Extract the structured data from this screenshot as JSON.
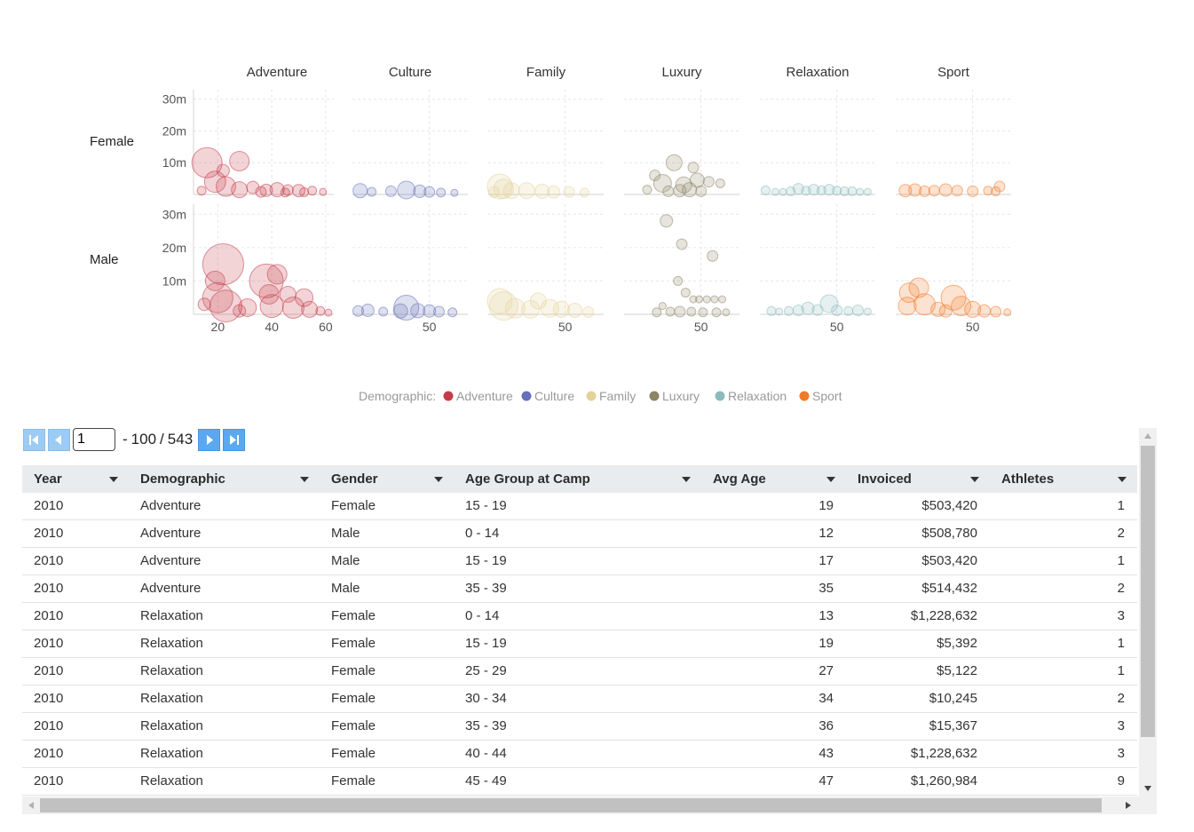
{
  "chart_data": {
    "type": "scatter",
    "facet_columns": [
      "Adventure",
      "Culture",
      "Family",
      "Luxury",
      "Relaxation",
      "Sport"
    ],
    "facet_rows": [
      "Female",
      "Male"
    ],
    "y_ticks": [
      "10m",
      "20m",
      "30m"
    ],
    "x_ticks_first": [
      "20",
      "40",
      "60"
    ],
    "x_ticks_other": [
      "50"
    ],
    "ylim": [
      0,
      33
    ],
    "x_range_first": [
      11,
      63
    ],
    "x_range_other": [
      10,
      70
    ],
    "colors": {
      "Adventure": "#c43c48",
      "Culture": "#6670b8",
      "Family": "#e5d19a",
      "Luxury": "#8c8566",
      "Relaxation": "#8bbcbc",
      "Sport": "#f07a2a"
    },
    "legend": {
      "title": "Demographic:",
      "items": [
        "Adventure",
        "Culture",
        "Family",
        "Luxury",
        "Relaxation",
        "Sport"
      ],
      "placement": "bottom-center"
    },
    "series": [
      {
        "name": "Adventure",
        "gender": "Female",
        "points": [
          {
            "x": 16,
            "y": 10,
            "r": 17
          },
          {
            "x": 28,
            "y": 10.5,
            "r": 11
          },
          {
            "x": 22,
            "y": 7.5,
            "r": 7
          },
          {
            "x": 19,
            "y": 4,
            "r": 12
          },
          {
            "x": 23,
            "y": 2.5,
            "r": 11
          },
          {
            "x": 28,
            "y": 1.5,
            "r": 9
          },
          {
            "x": 33,
            "y": 2.2,
            "r": 7
          },
          {
            "x": 38,
            "y": 1.3,
            "r": 7
          },
          {
            "x": 42,
            "y": 1.5,
            "r": 8
          },
          {
            "x": 46,
            "y": 1.4,
            "r": 6
          },
          {
            "x": 50,
            "y": 1.2,
            "r": 7
          },
          {
            "x": 55,
            "y": 1.2,
            "r": 5
          },
          {
            "x": 59,
            "y": 0.8,
            "r": 4
          },
          {
            "x": 14,
            "y": 1.2,
            "r": 5
          },
          {
            "x": 36,
            "y": 0.8,
            "r": 6
          },
          {
            "x": 45,
            "y": 0.6,
            "r": 5
          },
          {
            "x": 52,
            "y": 0.7,
            "r": 5
          }
        ]
      },
      {
        "name": "Adventure",
        "gender": "Male",
        "points": [
          {
            "x": 22,
            "y": 15,
            "r": 23
          },
          {
            "x": 19,
            "y": 10,
            "r": 11
          },
          {
            "x": 20,
            "y": 5,
            "r": 17
          },
          {
            "x": 23,
            "y": 2.5,
            "r": 18
          },
          {
            "x": 38,
            "y": 10,
            "r": 19
          },
          {
            "x": 42,
            "y": 12,
            "r": 11
          },
          {
            "x": 39,
            "y": 6,
            "r": 11
          },
          {
            "x": 46,
            "y": 6,
            "r": 9
          },
          {
            "x": 52,
            "y": 5,
            "r": 10
          },
          {
            "x": 40,
            "y": 2.5,
            "r": 13
          },
          {
            "x": 48,
            "y": 2,
            "r": 12
          },
          {
            "x": 54,
            "y": 1.5,
            "r": 9
          },
          {
            "x": 31,
            "y": 2,
            "r": 10
          },
          {
            "x": 15,
            "y": 3,
            "r": 7
          },
          {
            "x": 28,
            "y": 1,
            "r": 7
          },
          {
            "x": 58,
            "y": 1,
            "r": 5
          },
          {
            "x": 61,
            "y": 0.5,
            "r": 4
          }
        ]
      },
      {
        "name": "Culture",
        "gender": "Female",
        "points": [
          {
            "x": 14,
            "y": 1.2,
            "r": 8
          },
          {
            "x": 20,
            "y": 0.8,
            "r": 5
          },
          {
            "x": 30,
            "y": 1,
            "r": 6
          },
          {
            "x": 38,
            "y": 1.4,
            "r": 10
          },
          {
            "x": 45,
            "y": 1,
            "r": 7
          },
          {
            "x": 50,
            "y": 0.8,
            "r": 6
          },
          {
            "x": 56,
            "y": 0.6,
            "r": 5
          },
          {
            "x": 63,
            "y": 0.5,
            "r": 4
          }
        ]
      },
      {
        "name": "Culture",
        "gender": "Male",
        "points": [
          {
            "x": 13,
            "y": 1,
            "r": 6
          },
          {
            "x": 18,
            "y": 1.2,
            "r": 7
          },
          {
            "x": 26,
            "y": 0.8,
            "r": 5
          },
          {
            "x": 35,
            "y": 1,
            "r": 8
          },
          {
            "x": 38,
            "y": 2,
            "r": 14
          },
          {
            "x": 44,
            "y": 1.1,
            "r": 8
          },
          {
            "x": 50,
            "y": 1,
            "r": 7
          },
          {
            "x": 55,
            "y": 0.8,
            "r": 6
          },
          {
            "x": 62,
            "y": 0.6,
            "r": 5
          }
        ]
      },
      {
        "name": "Family",
        "gender": "Female",
        "points": [
          {
            "x": 16,
            "y": 2.5,
            "r": 14
          },
          {
            "x": 18,
            "y": 1.8,
            "r": 11
          },
          {
            "x": 22,
            "y": 1.2,
            "r": 9
          },
          {
            "x": 30,
            "y": 1.2,
            "r": 9
          },
          {
            "x": 38,
            "y": 1,
            "r": 8
          },
          {
            "x": 44,
            "y": 0.8,
            "r": 7
          },
          {
            "x": 52,
            "y": 0.8,
            "r": 6
          },
          {
            "x": 60,
            "y": 0.6,
            "r": 5
          },
          {
            "x": 13,
            "y": 0.8,
            "r": 6
          }
        ]
      },
      {
        "name": "Family",
        "gender": "Male",
        "points": [
          {
            "x": 16,
            "y": 4,
            "r": 14
          },
          {
            "x": 18,
            "y": 2.5,
            "r": 16
          },
          {
            "x": 24,
            "y": 1.8,
            "r": 11
          },
          {
            "x": 32,
            "y": 1.5,
            "r": 10
          },
          {
            "x": 36,
            "y": 4,
            "r": 9
          },
          {
            "x": 42,
            "y": 1.8,
            "r": 10
          },
          {
            "x": 48,
            "y": 1.5,
            "r": 9
          },
          {
            "x": 55,
            "y": 1.2,
            "r": 8
          },
          {
            "x": 62,
            "y": 0.7,
            "r": 6
          }
        ]
      },
      {
        "name": "Luxury",
        "gender": "Female",
        "points": [
          {
            "x": 36,
            "y": 10,
            "r": 9
          },
          {
            "x": 46,
            "y": 8.5,
            "r": 6
          },
          {
            "x": 26,
            "y": 6,
            "r": 6
          },
          {
            "x": 30,
            "y": 3.5,
            "r": 10
          },
          {
            "x": 41,
            "y": 3,
            "r": 9
          },
          {
            "x": 48,
            "y": 4.5,
            "r": 8
          },
          {
            "x": 54,
            "y": 4,
            "r": 6
          },
          {
            "x": 60,
            "y": 3.5,
            "r": 5
          },
          {
            "x": 22,
            "y": 1.5,
            "r": 5
          },
          {
            "x": 33,
            "y": 1,
            "r": 6
          },
          {
            "x": 39,
            "y": 1.2,
            "r": 7
          },
          {
            "x": 44,
            "y": 1.5,
            "r": 8
          },
          {
            "x": 50,
            "y": 1,
            "r": 6
          }
        ]
      },
      {
        "name": "Luxury",
        "gender": "Male",
        "points": [
          {
            "x": 32,
            "y": 28,
            "r": 7
          },
          {
            "x": 40,
            "y": 21,
            "r": 6
          },
          {
            "x": 56,
            "y": 17.5,
            "r": 6
          },
          {
            "x": 38,
            "y": 10,
            "r": 5
          },
          {
            "x": 42,
            "y": 6.5,
            "r": 5
          },
          {
            "x": 46,
            "y": 4.5,
            "r": 4
          },
          {
            "x": 49,
            "y": 4.5,
            "r": 4
          },
          {
            "x": 53,
            "y": 4.5,
            "r": 4
          },
          {
            "x": 57,
            "y": 4.5,
            "r": 4
          },
          {
            "x": 61,
            "y": 4.5,
            "r": 4
          },
          {
            "x": 30,
            "y": 2.5,
            "r": 4
          },
          {
            "x": 27,
            "y": 0.6,
            "r": 5
          },
          {
            "x": 34,
            "y": 0.8,
            "r": 5
          },
          {
            "x": 39,
            "y": 0.8,
            "r": 6
          },
          {
            "x": 45,
            "y": 0.8,
            "r": 5
          },
          {
            "x": 51,
            "y": 0.6,
            "r": 5
          },
          {
            "x": 58,
            "y": 0.6,
            "r": 5
          },
          {
            "x": 63,
            "y": 0.6,
            "r": 4
          }
        ]
      },
      {
        "name": "Relaxation",
        "gender": "Female",
        "points": [
          {
            "x": 13,
            "y": 1.3,
            "r": 5
          },
          {
            "x": 18,
            "y": 0.8,
            "r": 4
          },
          {
            "x": 22,
            "y": 0.8,
            "r": 4
          },
          {
            "x": 26,
            "y": 1,
            "r": 5
          },
          {
            "x": 30,
            "y": 1.8,
            "r": 6
          },
          {
            "x": 34,
            "y": 1.2,
            "r": 5
          },
          {
            "x": 38,
            "y": 1.5,
            "r": 6
          },
          {
            "x": 42,
            "y": 1.3,
            "r": 5
          },
          {
            "x": 46,
            "y": 1.5,
            "r": 6
          },
          {
            "x": 50,
            "y": 1.2,
            "r": 5
          },
          {
            "x": 54,
            "y": 1,
            "r": 5
          },
          {
            "x": 58,
            "y": 1,
            "r": 5
          },
          {
            "x": 62,
            "y": 0.8,
            "r": 4
          },
          {
            "x": 66,
            "y": 0.8,
            "r": 4
          }
        ]
      },
      {
        "name": "Relaxation",
        "gender": "Male",
        "points": [
          {
            "x": 16,
            "y": 1,
            "r": 5
          },
          {
            "x": 20,
            "y": 0.8,
            "r": 4
          },
          {
            "x": 25,
            "y": 1,
            "r": 5
          },
          {
            "x": 30,
            "y": 1.2,
            "r": 6
          },
          {
            "x": 35,
            "y": 1.8,
            "r": 7
          },
          {
            "x": 40,
            "y": 1.3,
            "r": 6
          },
          {
            "x": 46,
            "y": 3.2,
            "r": 10
          },
          {
            "x": 50,
            "y": 1.2,
            "r": 6
          },
          {
            "x": 56,
            "y": 1,
            "r": 5
          },
          {
            "x": 61,
            "y": 1.2,
            "r": 6
          },
          {
            "x": 66,
            "y": 0.8,
            "r": 4
          }
        ]
      },
      {
        "name": "Sport",
        "gender": "Female",
        "points": [
          {
            "x": 15,
            "y": 1.2,
            "r": 7
          },
          {
            "x": 20,
            "y": 1.4,
            "r": 7
          },
          {
            "x": 25,
            "y": 1,
            "r": 6
          },
          {
            "x": 30,
            "y": 1.2,
            "r": 6
          },
          {
            "x": 36,
            "y": 1.4,
            "r": 7
          },
          {
            "x": 42,
            "y": 1.2,
            "r": 6
          },
          {
            "x": 50,
            "y": 1,
            "r": 6
          },
          {
            "x": 58,
            "y": 1.2,
            "r": 5
          },
          {
            "x": 64,
            "y": 2.5,
            "r": 6
          },
          {
            "x": 62,
            "y": 1,
            "r": 5
          }
        ]
      },
      {
        "name": "Sport",
        "gender": "Male",
        "points": [
          {
            "x": 17,
            "y": 6.5,
            "r": 11
          },
          {
            "x": 22,
            "y": 8,
            "r": 11
          },
          {
            "x": 16,
            "y": 2.5,
            "r": 10
          },
          {
            "x": 25,
            "y": 3,
            "r": 12
          },
          {
            "x": 40,
            "y": 5,
            "r": 14
          },
          {
            "x": 44,
            "y": 2.5,
            "r": 11
          },
          {
            "x": 32,
            "y": 1.5,
            "r": 8
          },
          {
            "x": 50,
            "y": 1.5,
            "r": 9
          },
          {
            "x": 56,
            "y": 1,
            "r": 7
          },
          {
            "x": 62,
            "y": 0.8,
            "r": 6
          },
          {
            "x": 68,
            "y": 0.6,
            "r": 4
          },
          {
            "x": 36,
            "y": 1,
            "r": 7
          }
        ]
      }
    ]
  },
  "pager": {
    "page": "1",
    "range_sep": "-",
    "range_end": "100",
    "slash": "/",
    "total": "543"
  },
  "table": {
    "columns": [
      "Year",
      "Demographic",
      "Gender",
      "Age Group at Camp",
      "Avg Age",
      "Invoiced",
      "Athletes"
    ],
    "rows": [
      [
        "2010",
        "Adventure",
        "Female",
        "15 - 19",
        "19",
        "$503,420",
        "1"
      ],
      [
        "2010",
        "Adventure",
        "Male",
        "0 - 14",
        "12",
        "$508,780",
        "2"
      ],
      [
        "2010",
        "Adventure",
        "Male",
        "15 - 19",
        "17",
        "$503,420",
        "1"
      ],
      [
        "2010",
        "Adventure",
        "Male",
        "35 - 39",
        "35",
        "$514,432",
        "2"
      ],
      [
        "2010",
        "Relaxation",
        "Female",
        "0 - 14",
        "13",
        "$1,228,632",
        "3"
      ],
      [
        "2010",
        "Relaxation",
        "Female",
        "15 - 19",
        "19",
        "$5,392",
        "1"
      ],
      [
        "2010",
        "Relaxation",
        "Female",
        "25 - 29",
        "27",
        "$5,122",
        "1"
      ],
      [
        "2010",
        "Relaxation",
        "Female",
        "30 - 34",
        "34",
        "$10,245",
        "2"
      ],
      [
        "2010",
        "Relaxation",
        "Female",
        "35 - 39",
        "36",
        "$15,367",
        "3"
      ],
      [
        "2010",
        "Relaxation",
        "Female",
        "40 - 44",
        "43",
        "$1,228,632",
        "3"
      ],
      [
        "2010",
        "Relaxation",
        "Female",
        "45 - 49",
        "47",
        "$1,260,984",
        "9"
      ]
    ]
  }
}
